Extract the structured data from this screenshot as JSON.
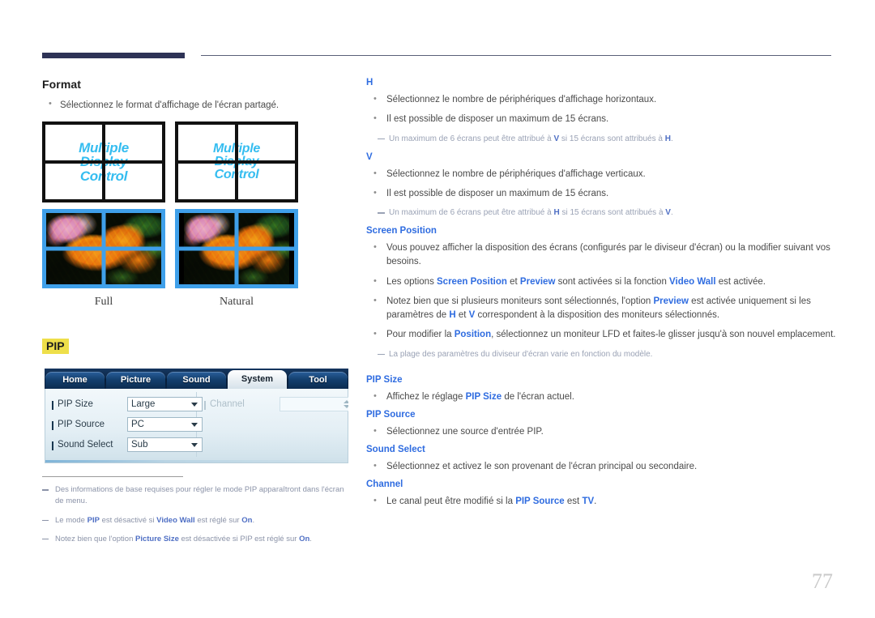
{
  "page_number": "77",
  "left": {
    "format": {
      "heading": "Format",
      "bullets": [
        "Sélectionnez le format d'affichage de l'écran partagé."
      ]
    },
    "figures": [
      {
        "caption": "Full",
        "wall_text_lines": [
          "Multiple",
          "Display",
          "Control"
        ],
        "mode": "full"
      },
      {
        "caption": "Natural",
        "wall_text_lines": [
          "Multiple",
          "Display",
          "Control"
        ],
        "mode": "natural"
      }
    ],
    "pip_heading": "PIP",
    "osd": {
      "tabs": [
        {
          "label": "Home",
          "active": false
        },
        {
          "label": "Picture",
          "active": false
        },
        {
          "label": "Sound",
          "active": false
        },
        {
          "label": "System",
          "active": true
        },
        {
          "label": "Tool",
          "active": false
        }
      ],
      "rows": [
        {
          "label": "PIP Size",
          "value": "Large",
          "disabled": false
        },
        {
          "label": "PIP Source",
          "value": "PC",
          "disabled": false
        },
        {
          "label": "Sound Select",
          "value": "Sub",
          "disabled": false
        }
      ],
      "channel": {
        "label": "Channel",
        "value": "",
        "disabled": true
      }
    },
    "footnotes": [
      "Des informations de base requises pour régler le mode PIP apparaîtront dans l'écran de menu.",
      "Le mode <b>PIP</b> est désactivé si <b>Video Wall</b> est réglé sur <b>On</b>.",
      "Notez bien que l'option <b>Picture Size</b> est désactivée si PIP est réglé sur <b>On</b>."
    ]
  },
  "right": {
    "sections": [
      {
        "heading": "H",
        "bullets": [
          "Sélectionnez le nombre de périphériques d'affichage horizontaux.",
          "Il est possible de disposer un maximum de 15 écrans."
        ],
        "notes": [
          "Un maximum de 6 écrans peut être attribué à <b>V</b> si 15 écrans sont attribués à <b>H</b>."
        ]
      },
      {
        "heading": "V",
        "bullets": [
          "Sélectionnez le nombre de périphériques d'affichage verticaux.",
          "Il est possible de disposer un maximum de 15 écrans."
        ],
        "notes": [
          "Un maximum de 6 écrans peut être attribué à <b>H</b> si 15 écrans sont attribués à <b>V</b>."
        ]
      },
      {
        "heading": "Screen Position",
        "bullets": [
          "Vous pouvez afficher la disposition des écrans (configurés par le diviseur d'écran) ou la modifier suivant vos besoins.",
          "Les options <b>Screen Position</b> et <b>Preview</b> sont activées si la fonction <b>Video Wall</b> est activée.",
          "Notez bien que si plusieurs moniteurs sont sélectionnés, l'option <b>Preview</b> est activée uniquement si les paramètres de <b>H</b> et <b>V</b> correspondent à la disposition des moniteurs sélectionnés.",
          "Pour modifier la <b>Position</b>, sélectionnez un moniteur LFD et faites-le glisser jusqu'à son nouvel emplacement."
        ],
        "notes": [
          "La plage des paramètres du diviseur d'écran varie en fonction du modèle."
        ]
      },
      {
        "heading": "PIP Size",
        "bullets": [
          "Affichez le réglage <b>PIP Size</b> de l'écran actuel."
        ],
        "notes": []
      },
      {
        "heading": "PIP Source",
        "bullets": [
          "Sélectionnez une source d'entrée PIP."
        ],
        "notes": []
      },
      {
        "heading": "Sound Select",
        "bullets": [
          "Sélectionnez et activez le son provenant de l'écran principal ou secondaire."
        ],
        "notes": []
      },
      {
        "heading": "Channel",
        "bullets": [
          "Le canal peut être modifié si la <b>PIP Source</b> est <b>TV</b>."
        ],
        "notes": []
      }
    ]
  },
  "colors": {
    "heading_blue": "#2f6ce0",
    "header_bar": "#2e3356",
    "highlight_yellow": "#eedf4a",
    "wall_text": "#35bdf0",
    "photo_border": "#3fa0ea"
  }
}
